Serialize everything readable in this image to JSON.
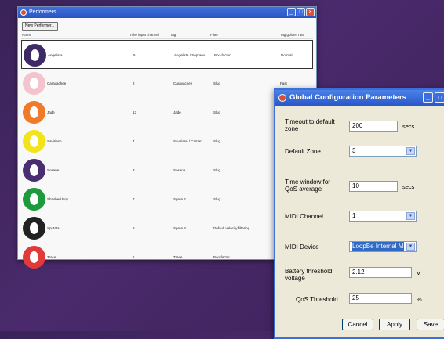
{
  "performers_window": {
    "title": "Performers",
    "new_button": "New Performer...",
    "columns": [
      "Name",
      "Tithe input channel",
      "Tag",
      "Filter",
      "Tag golden rate"
    ],
    "rows": [
      {
        "name": "Angelista",
        "channel": "5",
        "tag": "Angelista / Soprano",
        "filter": "Boo-factor",
        "rate": "Normal",
        "ring_color": "#3e2a66"
      },
      {
        "name": "Caravachee",
        "channel": "2",
        "tag": "Caravachee",
        "filter": "Slug",
        "rate": "Fast",
        "ring_color": "#f3c4cd"
      },
      {
        "name": "Jade",
        "channel": "13",
        "tag": "Jade",
        "filter": "Slug",
        "rate": "",
        "ring_color": "#ef7a2a"
      },
      {
        "name": "Saviriasn",
        "channel": "4",
        "tag": "Saviriasn / Caman",
        "filter": "Slug",
        "rate": "",
        "ring_color": "#f2e31a"
      },
      {
        "name": "Sosane",
        "channel": "3",
        "tag": "Sosane",
        "filter": "Slug",
        "rate": "",
        "ring_color": "#4a2f70"
      },
      {
        "name": "Shashed Boy",
        "channel": "7",
        "tag": "Spare 2",
        "filter": "Slug",
        "rate": "",
        "ring_color": "#1d9a3c"
      },
      {
        "name": "Sputata",
        "channel": "8",
        "tag": "Spare 3",
        "filter": "Default velocity filtering",
        "rate": "",
        "ring_color": "#222222"
      },
      {
        "name": "Trace",
        "channel": "1",
        "tag": "Trace",
        "filter": "Boo-factor",
        "rate": "",
        "ring_color": "#e23a3a"
      }
    ]
  },
  "config_window": {
    "title": "Global Configuration Parameters",
    "fields": {
      "timeout": {
        "label": "Timeout to default zone",
        "value": "200",
        "unit": "secs"
      },
      "default_zone": {
        "label": "Default Zone",
        "value": "3"
      },
      "time_window": {
        "label": "Time window for QoS average",
        "value": "10",
        "unit": "secs"
      },
      "midi_channel": {
        "label": "MIDI Channel",
        "value": "1"
      },
      "midi_device": {
        "label": "MIDI Device",
        "value": "LoopBe Internal MIDI"
      },
      "battery": {
        "label": "Battery threshold voltage",
        "value": "2.12",
        "unit": "V"
      },
      "qos": {
        "label": "QoS Threshold",
        "value": "25",
        "unit": "%"
      }
    },
    "buttons": {
      "cancel": "Cancel",
      "apply": "Apply",
      "save": "Save"
    }
  }
}
